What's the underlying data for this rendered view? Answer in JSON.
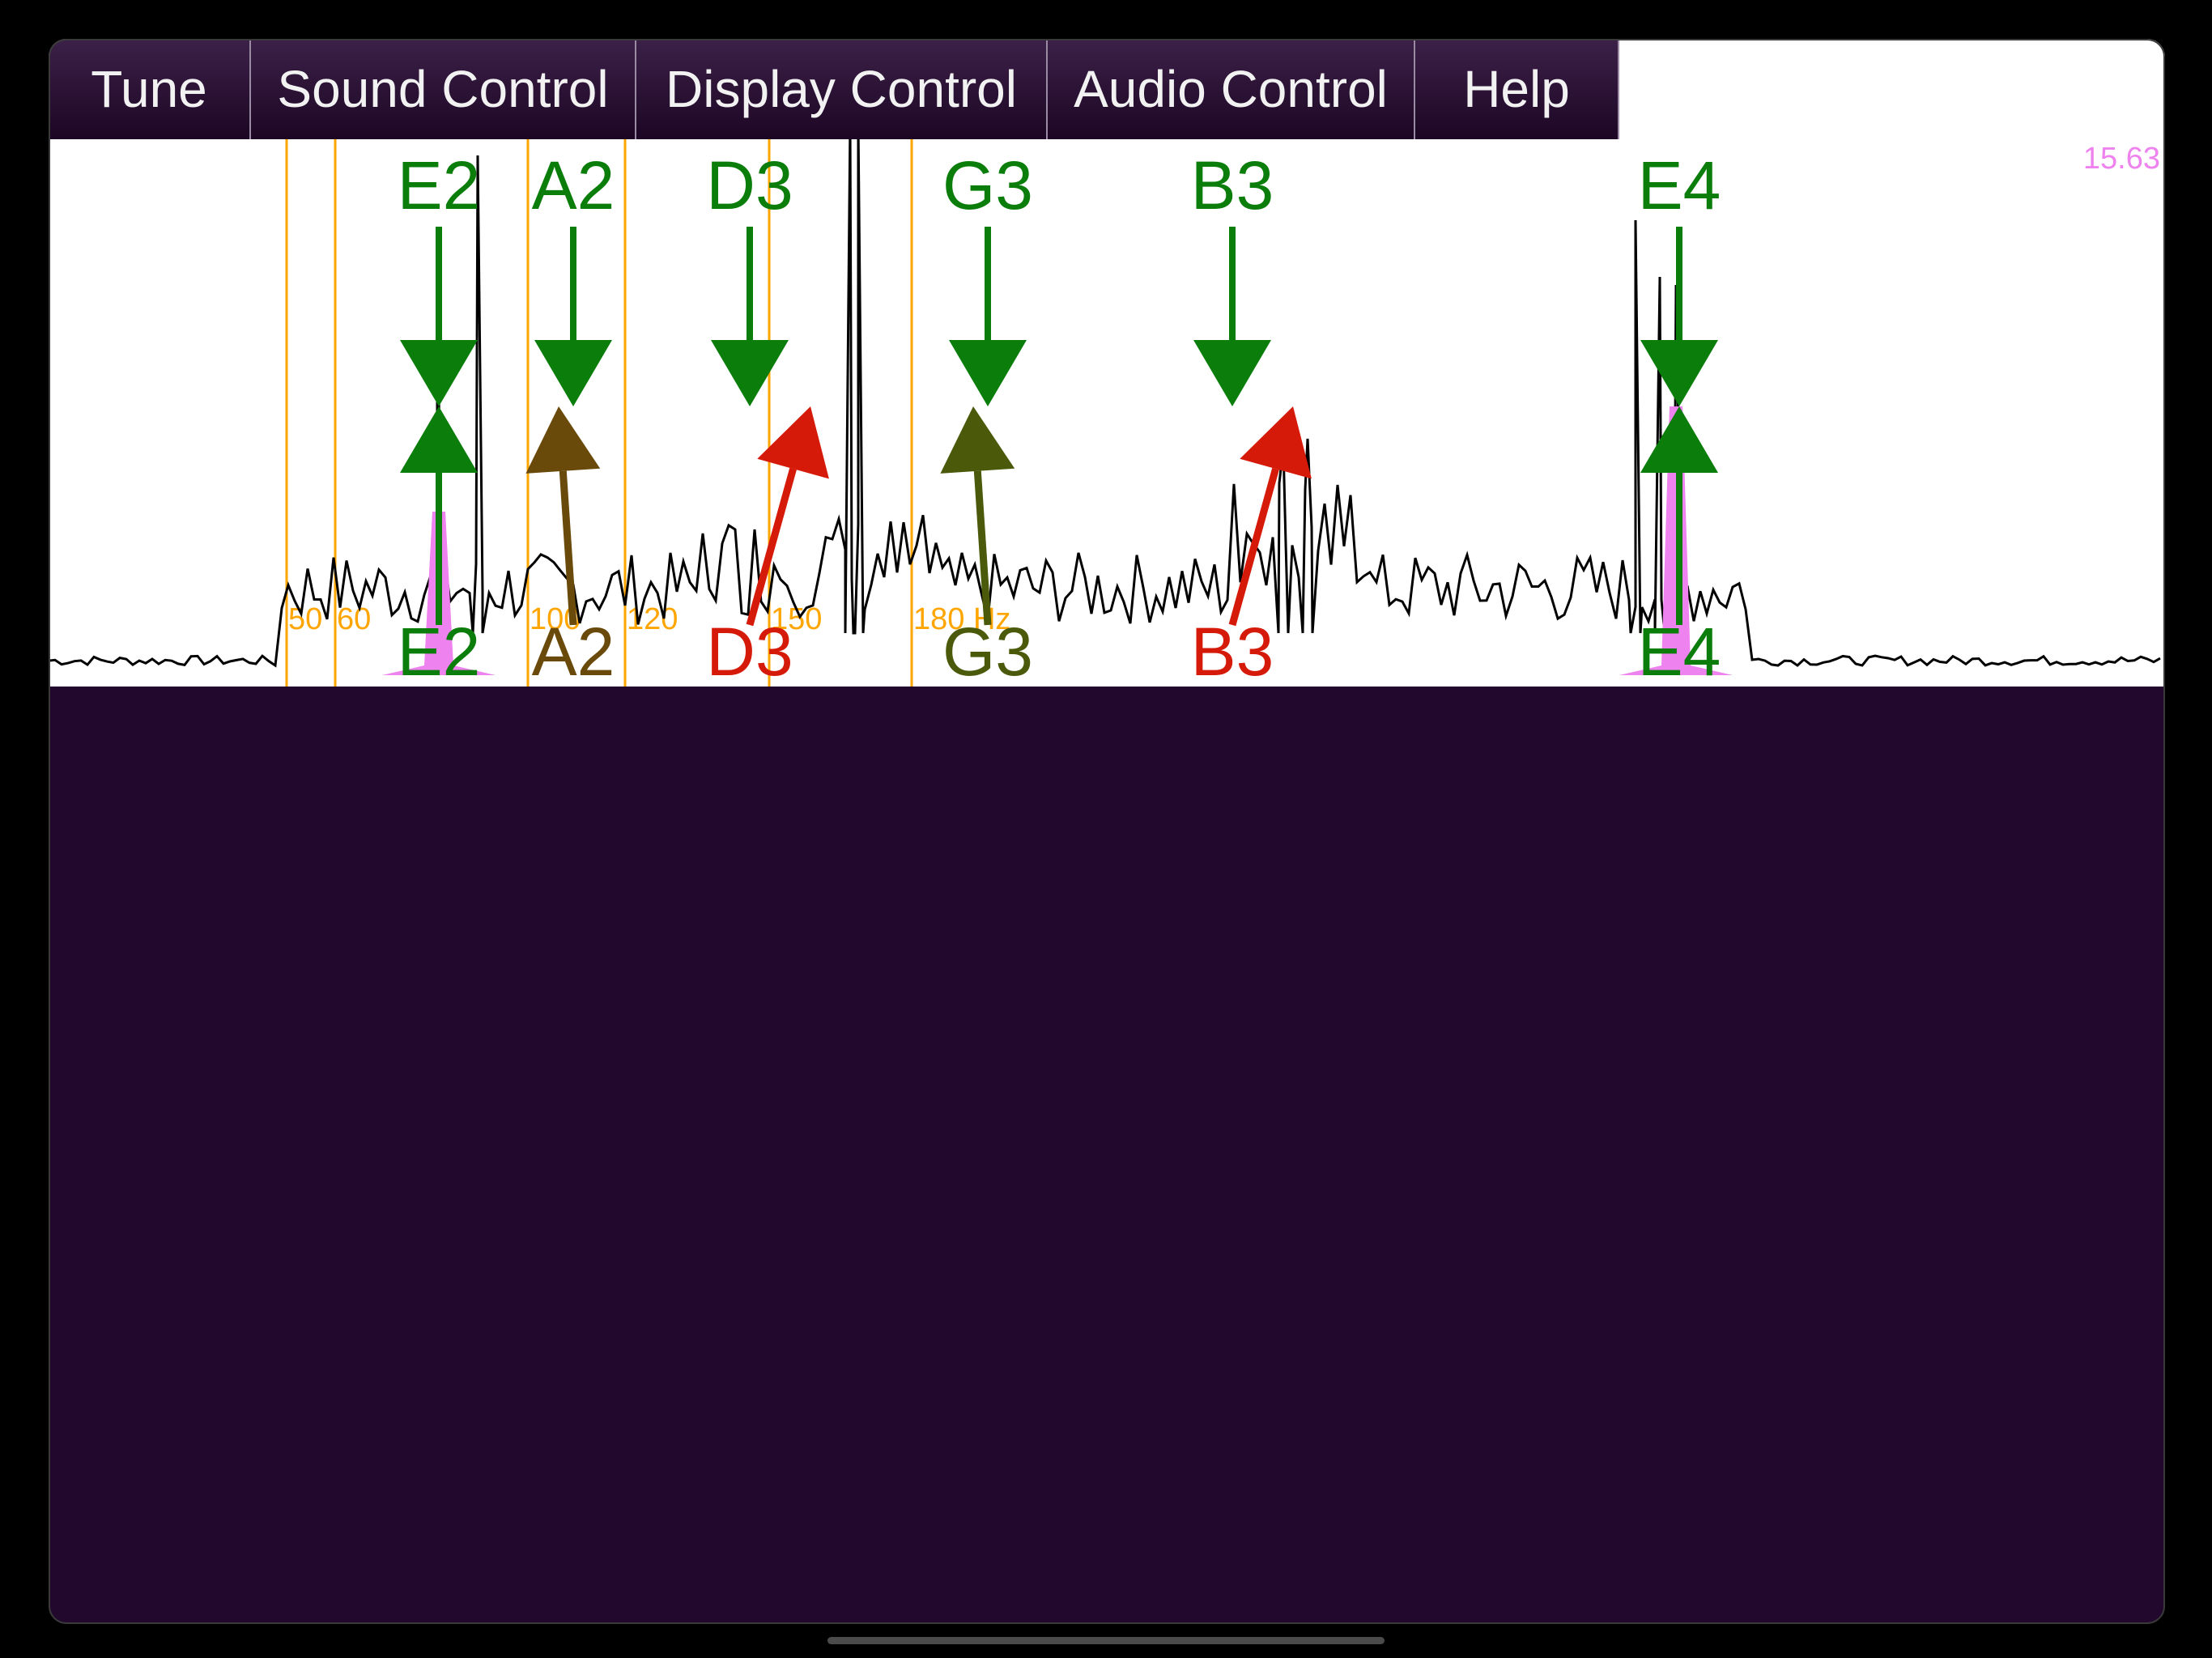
{
  "menu": {
    "tabs": [
      {
        "label": "Tune"
      },
      {
        "label": "Sound Control"
      },
      {
        "label": "Display Control"
      },
      {
        "label": "Audio Control"
      },
      {
        "label": "Help"
      }
    ]
  },
  "tuner": {
    "level_readout": "15.63",
    "freq_markers": [
      "50",
      "60",
      "100",
      "120",
      "150",
      "180 Hz"
    ],
    "strings": [
      {
        "note": "E2",
        "direction": "in-tune",
        "status_color": "#0a7d0a"
      },
      {
        "note": "A2",
        "direction": "flat",
        "status_color": "#6a4a0a"
      },
      {
        "note": "D3",
        "direction": "sharp",
        "status_color": "#d61a0a"
      },
      {
        "note": "G3",
        "direction": "flat",
        "status_color": "#4a5a0a"
      },
      {
        "note": "B3",
        "direction": "sharp",
        "status_color": "#d61a0a"
      },
      {
        "note": "E4",
        "direction": "in-tune",
        "status_color": "#0a7d0a"
      }
    ],
    "colors": {
      "target_arrow": "#0a7d0a",
      "marker_line": "#ffa500",
      "peak_fill": "#ee82ee",
      "spectrum_line": "#000000"
    }
  }
}
